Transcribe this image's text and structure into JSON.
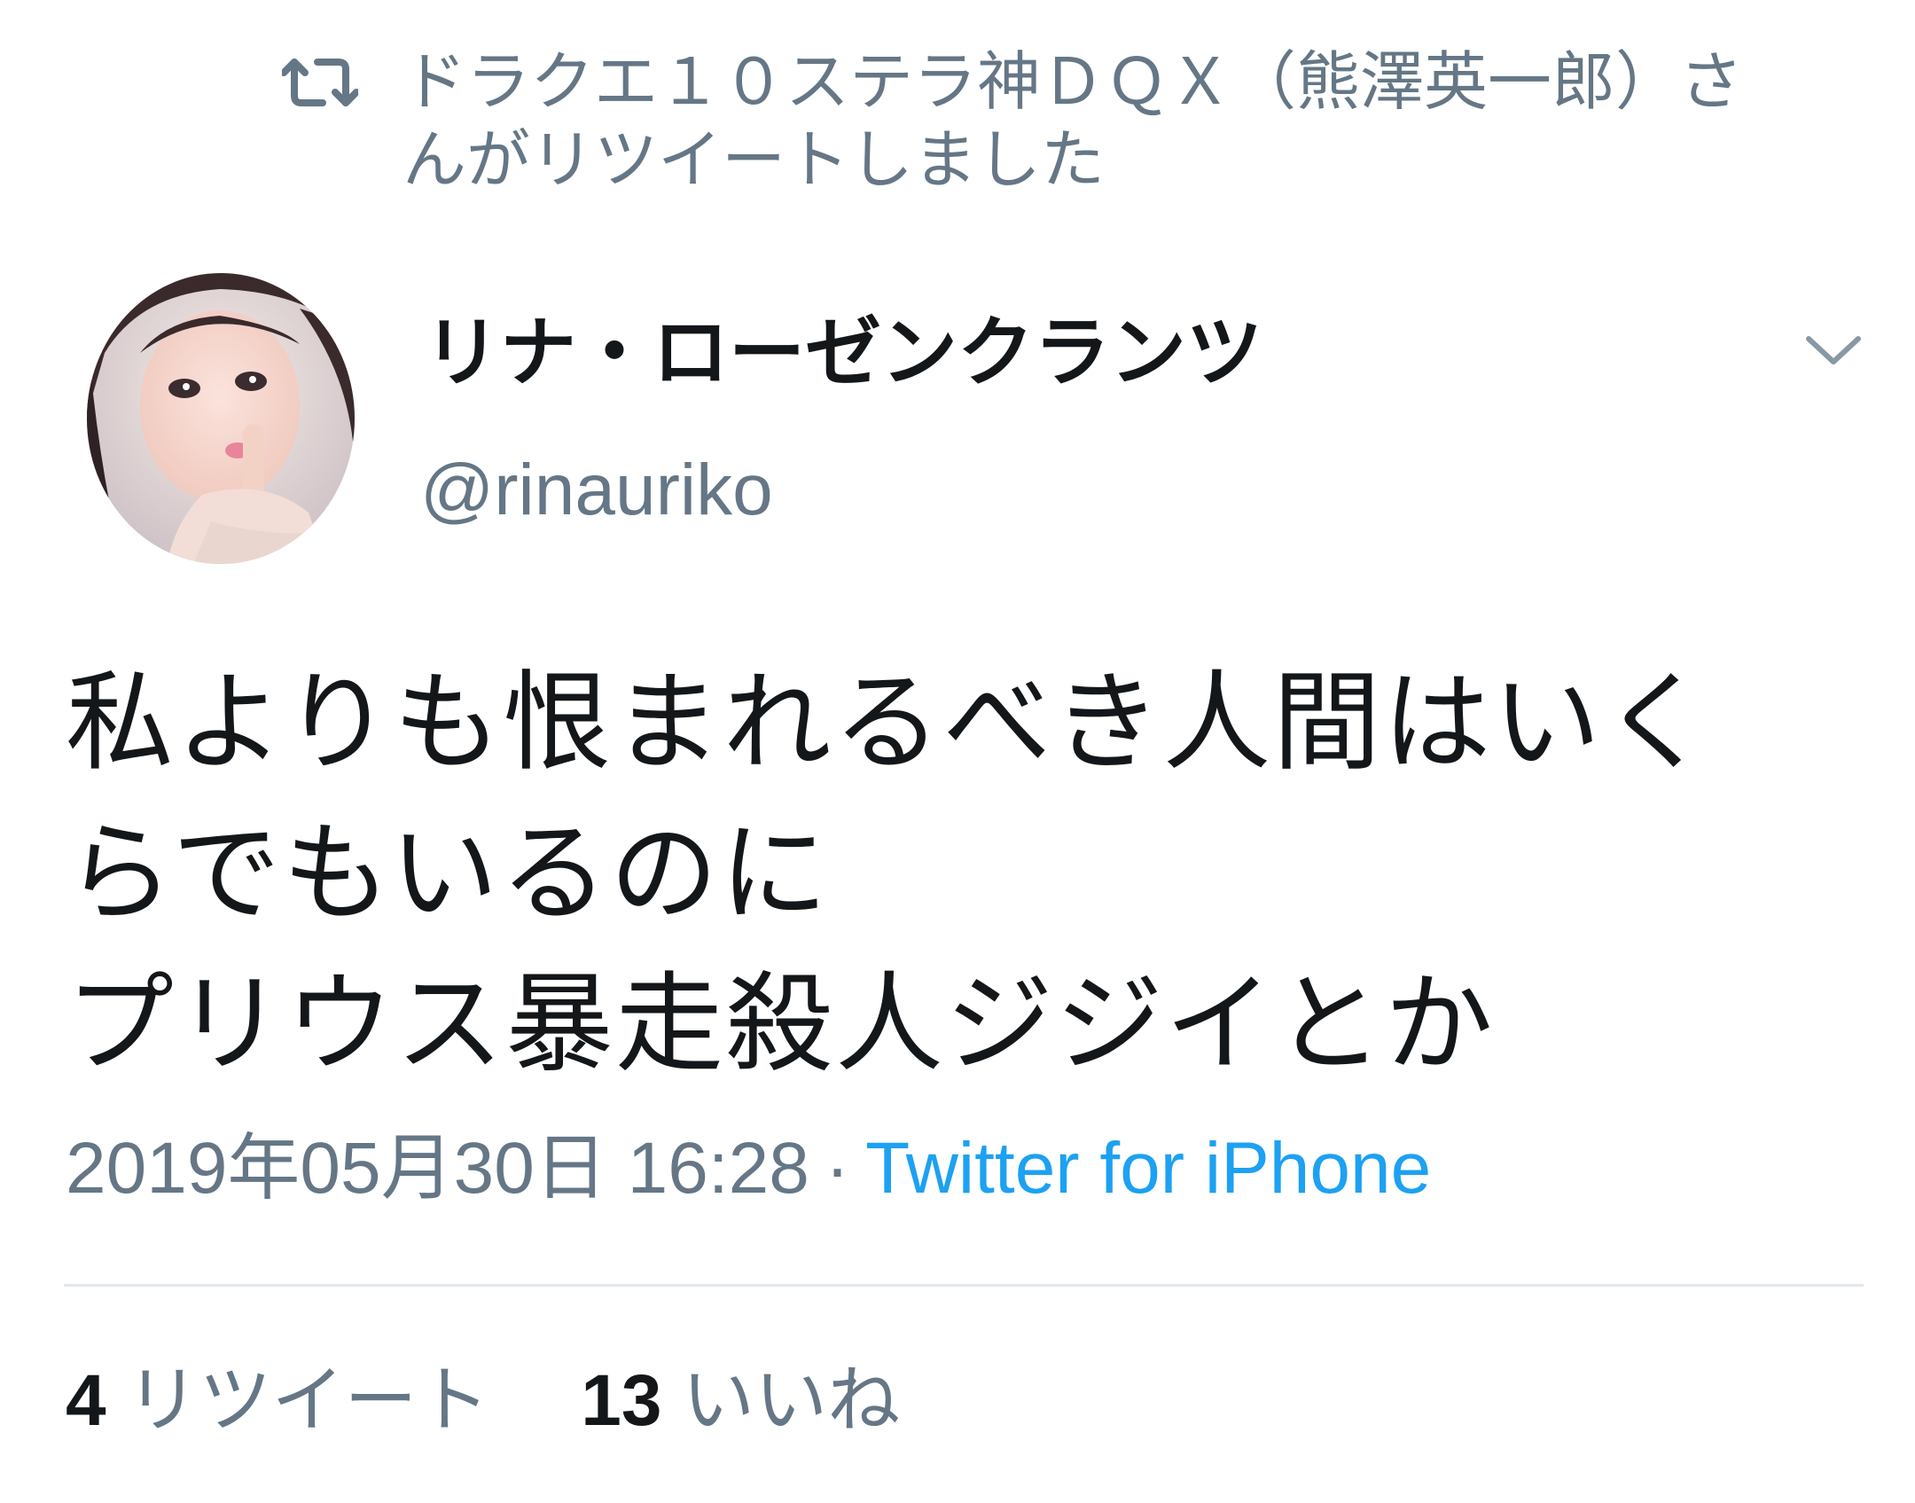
{
  "retweet_context": {
    "icon": "retweet-icon",
    "text": "ドラクエ１０ステラ神ＤＱＸ（熊澤英一郎）さんがリツイートしました"
  },
  "author": {
    "display_name": "リナ・ローゼンクランツ",
    "handle": "@rinauriko",
    "avatar_icon": "user-avatar"
  },
  "menu": {
    "icon": "chevron-down-icon"
  },
  "tweet": {
    "lines": [
      "私よりも恨まれるべき人間はいく",
      "らでもいるのに",
      "プリウス暴走殺人ジジイとか"
    ]
  },
  "meta": {
    "timestamp": "2019年05月30日 16:28",
    "separator": "·",
    "source": "Twitter for iPhone"
  },
  "stats": {
    "retweets_count": "4",
    "retweets_label": "リツイート",
    "likes_count": "13",
    "likes_label": "いいね"
  },
  "colors": {
    "secondary_text": "#657786",
    "link": "#1da1f2",
    "primary_text": "#14171a",
    "divider": "#e1e8ed"
  }
}
